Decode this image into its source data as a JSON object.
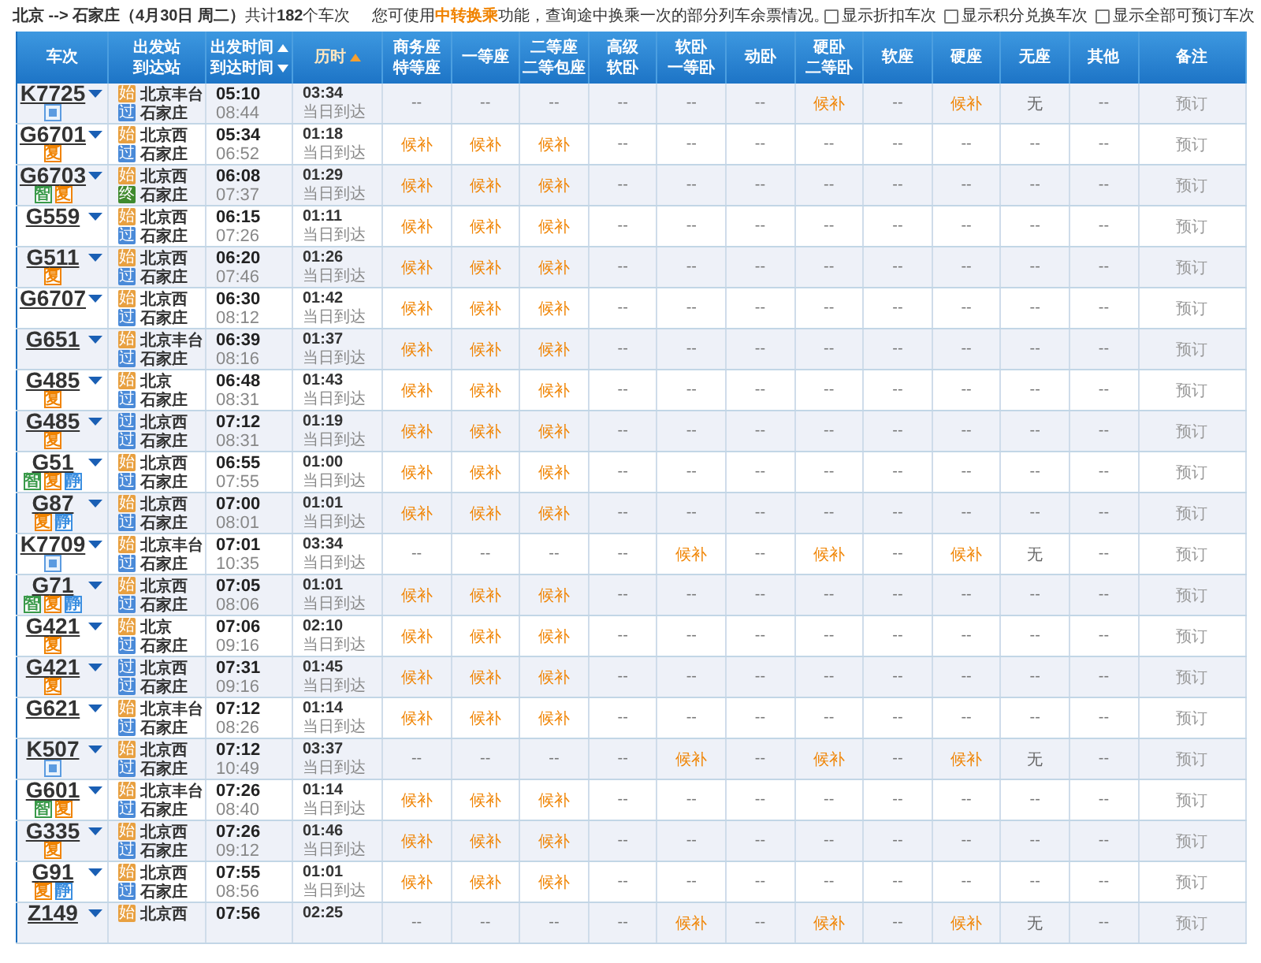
{
  "query": {
    "route": "**北京 --> 石家庄（4月30日 周二）**共计**182**个车次",
    "notice": {
      "before": "您可使用",
      "link": "中转换乘",
      "after": "功能，查询途中换乘一次的部分列车余票情况。"
    },
    "options": [
      {
        "label": "显示折扣车次",
        "checked": false
      },
      {
        "label": "显示积分兑换车次",
        "checked": false
      },
      {
        "label": "显示全部可预订车次",
        "checked": false
      }
    ]
  },
  "table": {
    "columns": [
      {
        "lines": [
          "车次"
        ],
        "sortable": false,
        "sorted": false
      },
      {
        "lines": [
          "出发站",
          "到达站"
        ],
        "sortable": false,
        "sorted": false
      },
      {
        "lines": [
          "出发时间",
          "到达时间"
        ],
        "sortable": true,
        "sorted": false
      },
      {
        "lines": [
          "历时"
        ],
        "sortable": true,
        "sorted": true
      },
      {
        "lines": [
          "商务座",
          "特等座"
        ],
        "sortable": false,
        "sorted": false
      },
      {
        "lines": [
          "一等座"
        ],
        "sortable": false,
        "sorted": false
      },
      {
        "lines": [
          "二等座",
          "二等包座"
        ],
        "sortable": false,
        "sorted": false
      },
      {
        "lines": [
          "高级",
          "软卧"
        ],
        "sortable": false,
        "sorted": false
      },
      {
        "lines": [
          "软卧",
          "一等卧"
        ],
        "sortable": false,
        "sorted": false
      },
      {
        "lines": [
          "动卧"
        ],
        "sortable": false,
        "sorted": false
      },
      {
        "lines": [
          "硬卧",
          "二等卧"
        ],
        "sortable": false,
        "sorted": false
      },
      {
        "lines": [
          "软座"
        ],
        "sortable": false,
        "sorted": false
      },
      {
        "lines": [
          "硬座"
        ],
        "sortable": false,
        "sorted": false
      },
      {
        "lines": [
          "无座"
        ],
        "sortable": false,
        "sorted": false
      },
      {
        "lines": [
          "其他"
        ],
        "sortable": false,
        "sorted": false
      },
      {
        "lines": [
          "备注"
        ],
        "sortable": false,
        "sorted": false
      }
    ],
    "rows": [
      {
        "train": "K7725",
        "tags": [
          {
            "kind": "sleeper"
          }
        ],
        "from": {
          "station": "北京丰台",
          "tag": "始",
          "kind": "start"
        },
        "to": {
          "station": "石家庄",
          "tag": "过",
          "kind": "pass"
        },
        "depart": "05:10",
        "arrive": "08:44",
        "duration": "03:34",
        "arrival_day": "当日到达",
        "seats": [
          {
            "text": "--",
            "kind": "empty"
          },
          {
            "text": "--",
            "kind": "empty"
          },
          {
            "text": "--",
            "kind": "empty"
          },
          {
            "text": "--",
            "kind": "empty"
          },
          {
            "text": "--",
            "kind": "empty"
          },
          {
            "text": "--",
            "kind": "empty"
          },
          {
            "text": "候补",
            "kind": "waitlist"
          },
          {
            "text": "--",
            "kind": "empty"
          },
          {
            "text": "候补",
            "kind": "waitlist"
          },
          {
            "text": "无",
            "kind": "soldout"
          },
          {
            "text": "--",
            "kind": "empty"
          }
        ],
        "action": "预订"
      },
      {
        "train": "G6701",
        "tags": [
          {
            "kind": "fuxing",
            "text": "复"
          }
        ],
        "from": {
          "station": "北京西",
          "tag": "始",
          "kind": "start"
        },
        "to": {
          "station": "石家庄",
          "tag": "过",
          "kind": "pass"
        },
        "depart": "05:34",
        "arrive": "06:52",
        "duration": "01:18",
        "arrival_day": "当日到达",
        "seats": [
          {
            "text": "候补",
            "kind": "waitlist"
          },
          {
            "text": "候补",
            "kind": "waitlist"
          },
          {
            "text": "候补",
            "kind": "waitlist"
          },
          {
            "text": "--",
            "kind": "empty"
          },
          {
            "text": "--",
            "kind": "empty"
          },
          {
            "text": "--",
            "kind": "empty"
          },
          {
            "text": "--",
            "kind": "empty"
          },
          {
            "text": "--",
            "kind": "empty"
          },
          {
            "text": "--",
            "kind": "empty"
          },
          {
            "text": "--",
            "kind": "empty"
          },
          {
            "text": "--",
            "kind": "empty"
          }
        ],
        "action": "预订"
      },
      {
        "train": "G6703",
        "tags": [
          {
            "kind": "smart",
            "text": "智"
          },
          {
            "kind": "fuxing",
            "text": "复"
          }
        ],
        "from": {
          "station": "北京西",
          "tag": "始",
          "kind": "start"
        },
        "to": {
          "station": "石家庄",
          "tag": "终",
          "kind": "end"
        },
        "depart": "06:08",
        "arrive": "07:37",
        "duration": "01:29",
        "arrival_day": "当日到达",
        "seats": [
          {
            "text": "候补",
            "kind": "waitlist"
          },
          {
            "text": "候补",
            "kind": "waitlist"
          },
          {
            "text": "候补",
            "kind": "waitlist"
          },
          {
            "text": "--",
            "kind": "empty"
          },
          {
            "text": "--",
            "kind": "empty"
          },
          {
            "text": "--",
            "kind": "empty"
          },
          {
            "text": "--",
            "kind": "empty"
          },
          {
            "text": "--",
            "kind": "empty"
          },
          {
            "text": "--",
            "kind": "empty"
          },
          {
            "text": "--",
            "kind": "empty"
          },
          {
            "text": "--",
            "kind": "empty"
          }
        ],
        "action": "预订"
      },
      {
        "train": "G559",
        "tags": [],
        "from": {
          "station": "北京西",
          "tag": "始",
          "kind": "start"
        },
        "to": {
          "station": "石家庄",
          "tag": "过",
          "kind": "pass"
        },
        "depart": "06:15",
        "arrive": "07:26",
        "duration": "01:11",
        "arrival_day": "当日到达",
        "seats": [
          {
            "text": "候补",
            "kind": "waitlist"
          },
          {
            "text": "候补",
            "kind": "waitlist"
          },
          {
            "text": "候补",
            "kind": "waitlist"
          },
          {
            "text": "--",
            "kind": "empty"
          },
          {
            "text": "--",
            "kind": "empty"
          },
          {
            "text": "--",
            "kind": "empty"
          },
          {
            "text": "--",
            "kind": "empty"
          },
          {
            "text": "--",
            "kind": "empty"
          },
          {
            "text": "--",
            "kind": "empty"
          },
          {
            "text": "--",
            "kind": "empty"
          },
          {
            "text": "--",
            "kind": "empty"
          }
        ],
        "action": "预订"
      },
      {
        "train": "G511",
        "tags": [
          {
            "kind": "fuxing",
            "text": "复"
          }
        ],
        "from": {
          "station": "北京西",
          "tag": "始",
          "kind": "start"
        },
        "to": {
          "station": "石家庄",
          "tag": "过",
          "kind": "pass"
        },
        "depart": "06:20",
        "arrive": "07:46",
        "duration": "01:26",
        "arrival_day": "当日到达",
        "seats": [
          {
            "text": "候补",
            "kind": "waitlist"
          },
          {
            "text": "候补",
            "kind": "waitlist"
          },
          {
            "text": "候补",
            "kind": "waitlist"
          },
          {
            "text": "--",
            "kind": "empty"
          },
          {
            "text": "--",
            "kind": "empty"
          },
          {
            "text": "--",
            "kind": "empty"
          },
          {
            "text": "--",
            "kind": "empty"
          },
          {
            "text": "--",
            "kind": "empty"
          },
          {
            "text": "--",
            "kind": "empty"
          },
          {
            "text": "--",
            "kind": "empty"
          },
          {
            "text": "--",
            "kind": "empty"
          }
        ],
        "action": "预订"
      },
      {
        "train": "G6707",
        "tags": [],
        "from": {
          "station": "北京西",
          "tag": "始",
          "kind": "start"
        },
        "to": {
          "station": "石家庄",
          "tag": "过",
          "kind": "pass"
        },
        "depart": "06:30",
        "arrive": "08:12",
        "duration": "01:42",
        "arrival_day": "当日到达",
        "seats": [
          {
            "text": "候补",
            "kind": "waitlist"
          },
          {
            "text": "候补",
            "kind": "waitlist"
          },
          {
            "text": "候补",
            "kind": "waitlist"
          },
          {
            "text": "--",
            "kind": "empty"
          },
          {
            "text": "--",
            "kind": "empty"
          },
          {
            "text": "--",
            "kind": "empty"
          },
          {
            "text": "--",
            "kind": "empty"
          },
          {
            "text": "--",
            "kind": "empty"
          },
          {
            "text": "--",
            "kind": "empty"
          },
          {
            "text": "--",
            "kind": "empty"
          },
          {
            "text": "--",
            "kind": "empty"
          }
        ],
        "action": "预订"
      },
      {
        "train": "G651",
        "tags": [],
        "from": {
          "station": "北京丰台",
          "tag": "始",
          "kind": "start"
        },
        "to": {
          "station": "石家庄",
          "tag": "过",
          "kind": "pass"
        },
        "depart": "06:39",
        "arrive": "08:16",
        "duration": "01:37",
        "arrival_day": "当日到达",
        "seats": [
          {
            "text": "候补",
            "kind": "waitlist"
          },
          {
            "text": "候补",
            "kind": "waitlist"
          },
          {
            "text": "候补",
            "kind": "waitlist"
          },
          {
            "text": "--",
            "kind": "empty"
          },
          {
            "text": "--",
            "kind": "empty"
          },
          {
            "text": "--",
            "kind": "empty"
          },
          {
            "text": "--",
            "kind": "empty"
          },
          {
            "text": "--",
            "kind": "empty"
          },
          {
            "text": "--",
            "kind": "empty"
          },
          {
            "text": "--",
            "kind": "empty"
          },
          {
            "text": "--",
            "kind": "empty"
          }
        ],
        "action": "预订"
      },
      {
        "train": "G485",
        "tags": [
          {
            "kind": "fuxing",
            "text": "复"
          }
        ],
        "from": {
          "station": "北京",
          "tag": "始",
          "kind": "start"
        },
        "to": {
          "station": "石家庄",
          "tag": "过",
          "kind": "pass"
        },
        "depart": "06:48",
        "arrive": "08:31",
        "duration": "01:43",
        "arrival_day": "当日到达",
        "seats": [
          {
            "text": "候补",
            "kind": "waitlist"
          },
          {
            "text": "候补",
            "kind": "waitlist"
          },
          {
            "text": "候补",
            "kind": "waitlist"
          },
          {
            "text": "--",
            "kind": "empty"
          },
          {
            "text": "--",
            "kind": "empty"
          },
          {
            "text": "--",
            "kind": "empty"
          },
          {
            "text": "--",
            "kind": "empty"
          },
          {
            "text": "--",
            "kind": "empty"
          },
          {
            "text": "--",
            "kind": "empty"
          },
          {
            "text": "--",
            "kind": "empty"
          },
          {
            "text": "--",
            "kind": "empty"
          }
        ],
        "action": "预订"
      },
      {
        "train": "G485",
        "tags": [
          {
            "kind": "fuxing",
            "text": "复"
          }
        ],
        "from": {
          "station": "北京西",
          "tag": "过",
          "kind": "pass"
        },
        "to": {
          "station": "石家庄",
          "tag": "过",
          "kind": "pass"
        },
        "depart": "07:12",
        "arrive": "08:31",
        "duration": "01:19",
        "arrival_day": "当日到达",
        "seats": [
          {
            "text": "候补",
            "kind": "waitlist"
          },
          {
            "text": "候补",
            "kind": "waitlist"
          },
          {
            "text": "候补",
            "kind": "waitlist"
          },
          {
            "text": "--",
            "kind": "empty"
          },
          {
            "text": "--",
            "kind": "empty"
          },
          {
            "text": "--",
            "kind": "empty"
          },
          {
            "text": "--",
            "kind": "empty"
          },
          {
            "text": "--",
            "kind": "empty"
          },
          {
            "text": "--",
            "kind": "empty"
          },
          {
            "text": "--",
            "kind": "empty"
          },
          {
            "text": "--",
            "kind": "empty"
          }
        ],
        "action": "预订"
      },
      {
        "train": "G51",
        "tags": [
          {
            "kind": "smart",
            "text": "智"
          },
          {
            "kind": "fuxing",
            "text": "复"
          },
          {
            "kind": "quiet",
            "text": "静"
          }
        ],
        "from": {
          "station": "北京西",
          "tag": "始",
          "kind": "start"
        },
        "to": {
          "station": "石家庄",
          "tag": "过",
          "kind": "pass"
        },
        "depart": "06:55",
        "arrive": "07:55",
        "duration": "01:00",
        "arrival_day": "当日到达",
        "seats": [
          {
            "text": "候补",
            "kind": "waitlist"
          },
          {
            "text": "候补",
            "kind": "waitlist"
          },
          {
            "text": "候补",
            "kind": "waitlist"
          },
          {
            "text": "--",
            "kind": "empty"
          },
          {
            "text": "--",
            "kind": "empty"
          },
          {
            "text": "--",
            "kind": "empty"
          },
          {
            "text": "--",
            "kind": "empty"
          },
          {
            "text": "--",
            "kind": "empty"
          },
          {
            "text": "--",
            "kind": "empty"
          },
          {
            "text": "--",
            "kind": "empty"
          },
          {
            "text": "--",
            "kind": "empty"
          }
        ],
        "action": "预订"
      },
      {
        "train": "G87",
        "tags": [
          {
            "kind": "fuxing",
            "text": "复"
          },
          {
            "kind": "quiet",
            "text": "静"
          }
        ],
        "from": {
          "station": "北京西",
          "tag": "始",
          "kind": "start"
        },
        "to": {
          "station": "石家庄",
          "tag": "过",
          "kind": "pass"
        },
        "depart": "07:00",
        "arrive": "08:01",
        "duration": "01:01",
        "arrival_day": "当日到达",
        "seats": [
          {
            "text": "候补",
            "kind": "waitlist"
          },
          {
            "text": "候补",
            "kind": "waitlist"
          },
          {
            "text": "候补",
            "kind": "waitlist"
          },
          {
            "text": "--",
            "kind": "empty"
          },
          {
            "text": "--",
            "kind": "empty"
          },
          {
            "text": "--",
            "kind": "empty"
          },
          {
            "text": "--",
            "kind": "empty"
          },
          {
            "text": "--",
            "kind": "empty"
          },
          {
            "text": "--",
            "kind": "empty"
          },
          {
            "text": "--",
            "kind": "empty"
          },
          {
            "text": "--",
            "kind": "empty"
          }
        ],
        "action": "预订"
      },
      {
        "train": "K7709",
        "tags": [
          {
            "kind": "sleeper"
          }
        ],
        "from": {
          "station": "北京丰台",
          "tag": "始",
          "kind": "start"
        },
        "to": {
          "station": "石家庄",
          "tag": "过",
          "kind": "pass"
        },
        "depart": "07:01",
        "arrive": "10:35",
        "duration": "03:34",
        "arrival_day": "当日到达",
        "seats": [
          {
            "text": "--",
            "kind": "empty"
          },
          {
            "text": "--",
            "kind": "empty"
          },
          {
            "text": "--",
            "kind": "empty"
          },
          {
            "text": "--",
            "kind": "empty"
          },
          {
            "text": "候补",
            "kind": "waitlist"
          },
          {
            "text": "--",
            "kind": "empty"
          },
          {
            "text": "候补",
            "kind": "waitlist"
          },
          {
            "text": "--",
            "kind": "empty"
          },
          {
            "text": "候补",
            "kind": "waitlist"
          },
          {
            "text": "无",
            "kind": "soldout"
          },
          {
            "text": "--",
            "kind": "empty"
          }
        ],
        "action": "预订"
      },
      {
        "train": "G71",
        "tags": [
          {
            "kind": "smart",
            "text": "智"
          },
          {
            "kind": "fuxing",
            "text": "复"
          },
          {
            "kind": "quiet",
            "text": "静"
          }
        ],
        "from": {
          "station": "北京西",
          "tag": "始",
          "kind": "start"
        },
        "to": {
          "station": "石家庄",
          "tag": "过",
          "kind": "pass"
        },
        "depart": "07:05",
        "arrive": "08:06",
        "duration": "01:01",
        "arrival_day": "当日到达",
        "seats": [
          {
            "text": "候补",
            "kind": "waitlist"
          },
          {
            "text": "候补",
            "kind": "waitlist"
          },
          {
            "text": "候补",
            "kind": "waitlist"
          },
          {
            "text": "--",
            "kind": "empty"
          },
          {
            "text": "--",
            "kind": "empty"
          },
          {
            "text": "--",
            "kind": "empty"
          },
          {
            "text": "--",
            "kind": "empty"
          },
          {
            "text": "--",
            "kind": "empty"
          },
          {
            "text": "--",
            "kind": "empty"
          },
          {
            "text": "--",
            "kind": "empty"
          },
          {
            "text": "--",
            "kind": "empty"
          }
        ],
        "action": "预订"
      },
      {
        "train": "G421",
        "tags": [
          {
            "kind": "fuxing",
            "text": "复"
          }
        ],
        "from": {
          "station": "北京",
          "tag": "始",
          "kind": "start"
        },
        "to": {
          "station": "石家庄",
          "tag": "过",
          "kind": "pass"
        },
        "depart": "07:06",
        "arrive": "09:16",
        "duration": "02:10",
        "arrival_day": "当日到达",
        "seats": [
          {
            "text": "候补",
            "kind": "waitlist"
          },
          {
            "text": "候补",
            "kind": "waitlist"
          },
          {
            "text": "候补",
            "kind": "waitlist"
          },
          {
            "text": "--",
            "kind": "empty"
          },
          {
            "text": "--",
            "kind": "empty"
          },
          {
            "text": "--",
            "kind": "empty"
          },
          {
            "text": "--",
            "kind": "empty"
          },
          {
            "text": "--",
            "kind": "empty"
          },
          {
            "text": "--",
            "kind": "empty"
          },
          {
            "text": "--",
            "kind": "empty"
          },
          {
            "text": "--",
            "kind": "empty"
          }
        ],
        "action": "预订"
      },
      {
        "train": "G421",
        "tags": [
          {
            "kind": "fuxing",
            "text": "复"
          }
        ],
        "from": {
          "station": "北京西",
          "tag": "过",
          "kind": "pass"
        },
        "to": {
          "station": "石家庄",
          "tag": "过",
          "kind": "pass"
        },
        "depart": "07:31",
        "arrive": "09:16",
        "duration": "01:45",
        "arrival_day": "当日到达",
        "seats": [
          {
            "text": "候补",
            "kind": "waitlist"
          },
          {
            "text": "候补",
            "kind": "waitlist"
          },
          {
            "text": "候补",
            "kind": "waitlist"
          },
          {
            "text": "--",
            "kind": "empty"
          },
          {
            "text": "--",
            "kind": "empty"
          },
          {
            "text": "--",
            "kind": "empty"
          },
          {
            "text": "--",
            "kind": "empty"
          },
          {
            "text": "--",
            "kind": "empty"
          },
          {
            "text": "--",
            "kind": "empty"
          },
          {
            "text": "--",
            "kind": "empty"
          },
          {
            "text": "--",
            "kind": "empty"
          }
        ],
        "action": "预订"
      },
      {
        "train": "G621",
        "tags": [],
        "from": {
          "station": "北京丰台",
          "tag": "始",
          "kind": "start"
        },
        "to": {
          "station": "石家庄",
          "tag": "过",
          "kind": "pass"
        },
        "depart": "07:12",
        "arrive": "08:26",
        "duration": "01:14",
        "arrival_day": "当日到达",
        "seats": [
          {
            "text": "候补",
            "kind": "waitlist"
          },
          {
            "text": "候补",
            "kind": "waitlist"
          },
          {
            "text": "候补",
            "kind": "waitlist"
          },
          {
            "text": "--",
            "kind": "empty"
          },
          {
            "text": "--",
            "kind": "empty"
          },
          {
            "text": "--",
            "kind": "empty"
          },
          {
            "text": "--",
            "kind": "empty"
          },
          {
            "text": "--",
            "kind": "empty"
          },
          {
            "text": "--",
            "kind": "empty"
          },
          {
            "text": "--",
            "kind": "empty"
          },
          {
            "text": "--",
            "kind": "empty"
          }
        ],
        "action": "预订"
      },
      {
        "train": "K507",
        "tags": [
          {
            "kind": "sleeper"
          }
        ],
        "from": {
          "station": "北京西",
          "tag": "始",
          "kind": "start"
        },
        "to": {
          "station": "石家庄",
          "tag": "过",
          "kind": "pass"
        },
        "depart": "07:12",
        "arrive": "10:49",
        "duration": "03:37",
        "arrival_day": "当日到达",
        "seats": [
          {
            "text": "--",
            "kind": "empty"
          },
          {
            "text": "--",
            "kind": "empty"
          },
          {
            "text": "--",
            "kind": "empty"
          },
          {
            "text": "--",
            "kind": "empty"
          },
          {
            "text": "候补",
            "kind": "waitlist"
          },
          {
            "text": "--",
            "kind": "empty"
          },
          {
            "text": "候补",
            "kind": "waitlist"
          },
          {
            "text": "--",
            "kind": "empty"
          },
          {
            "text": "候补",
            "kind": "waitlist"
          },
          {
            "text": "无",
            "kind": "soldout"
          },
          {
            "text": "--",
            "kind": "empty"
          }
        ],
        "action": "预订"
      },
      {
        "train": "G601",
        "tags": [
          {
            "kind": "smart",
            "text": "智"
          },
          {
            "kind": "fuxing",
            "text": "复"
          }
        ],
        "from": {
          "station": "北京丰台",
          "tag": "始",
          "kind": "start"
        },
        "to": {
          "station": "石家庄",
          "tag": "过",
          "kind": "pass"
        },
        "depart": "07:26",
        "arrive": "08:40",
        "duration": "01:14",
        "arrival_day": "当日到达",
        "seats": [
          {
            "text": "候补",
            "kind": "waitlist"
          },
          {
            "text": "候补",
            "kind": "waitlist"
          },
          {
            "text": "候补",
            "kind": "waitlist"
          },
          {
            "text": "--",
            "kind": "empty"
          },
          {
            "text": "--",
            "kind": "empty"
          },
          {
            "text": "--",
            "kind": "empty"
          },
          {
            "text": "--",
            "kind": "empty"
          },
          {
            "text": "--",
            "kind": "empty"
          },
          {
            "text": "--",
            "kind": "empty"
          },
          {
            "text": "--",
            "kind": "empty"
          },
          {
            "text": "--",
            "kind": "empty"
          }
        ],
        "action": "预订"
      },
      {
        "train": "G335",
        "tags": [
          {
            "kind": "fuxing",
            "text": "复"
          }
        ],
        "from": {
          "station": "北京西",
          "tag": "始",
          "kind": "start"
        },
        "to": {
          "station": "石家庄",
          "tag": "过",
          "kind": "pass"
        },
        "depart": "07:26",
        "arrive": "09:12",
        "duration": "01:46",
        "arrival_day": "当日到达",
        "seats": [
          {
            "text": "候补",
            "kind": "waitlist"
          },
          {
            "text": "候补",
            "kind": "waitlist"
          },
          {
            "text": "候补",
            "kind": "waitlist"
          },
          {
            "text": "--",
            "kind": "empty"
          },
          {
            "text": "--",
            "kind": "empty"
          },
          {
            "text": "--",
            "kind": "empty"
          },
          {
            "text": "--",
            "kind": "empty"
          },
          {
            "text": "--",
            "kind": "empty"
          },
          {
            "text": "--",
            "kind": "empty"
          },
          {
            "text": "--",
            "kind": "empty"
          },
          {
            "text": "--",
            "kind": "empty"
          }
        ],
        "action": "预订"
      },
      {
        "train": "G91",
        "tags": [
          {
            "kind": "fuxing",
            "text": "复"
          },
          {
            "kind": "quiet",
            "text": "静"
          }
        ],
        "from": {
          "station": "北京西",
          "tag": "始",
          "kind": "start"
        },
        "to": {
          "station": "石家庄",
          "tag": "过",
          "kind": "pass"
        },
        "depart": "07:55",
        "arrive": "08:56",
        "duration": "01:01",
        "arrival_day": "当日到达",
        "seats": [
          {
            "text": "候补",
            "kind": "waitlist"
          },
          {
            "text": "候补",
            "kind": "waitlist"
          },
          {
            "text": "候补",
            "kind": "waitlist"
          },
          {
            "text": "--",
            "kind": "empty"
          },
          {
            "text": "--",
            "kind": "empty"
          },
          {
            "text": "--",
            "kind": "empty"
          },
          {
            "text": "--",
            "kind": "empty"
          },
          {
            "text": "--",
            "kind": "empty"
          },
          {
            "text": "--",
            "kind": "empty"
          },
          {
            "text": "--",
            "kind": "empty"
          },
          {
            "text": "--",
            "kind": "empty"
          }
        ],
        "action": "预订"
      },
      {
        "train": "Z149",
        "tags": [],
        "from": {
          "station": "北京西",
          "tag": "始",
          "kind": "start"
        },
        "depart": "07:56",
        "duration": "02:25",
        "seats": [
          {
            "text": "--",
            "kind": "empty"
          },
          {
            "text": "--",
            "kind": "empty"
          },
          {
            "text": "--",
            "kind": "empty"
          },
          {
            "text": "--",
            "kind": "empty"
          },
          {
            "text": "候补",
            "kind": "waitlist"
          },
          {
            "text": "--",
            "kind": "empty"
          },
          {
            "text": "候补",
            "kind": "waitlist"
          },
          {
            "text": "--",
            "kind": "empty"
          },
          {
            "text": "候补",
            "kind": "waitlist"
          },
          {
            "text": "无",
            "kind": "soldout"
          },
          {
            "text": "--",
            "kind": "empty"
          }
        ],
        "action": "预订"
      }
    ]
  }
}
